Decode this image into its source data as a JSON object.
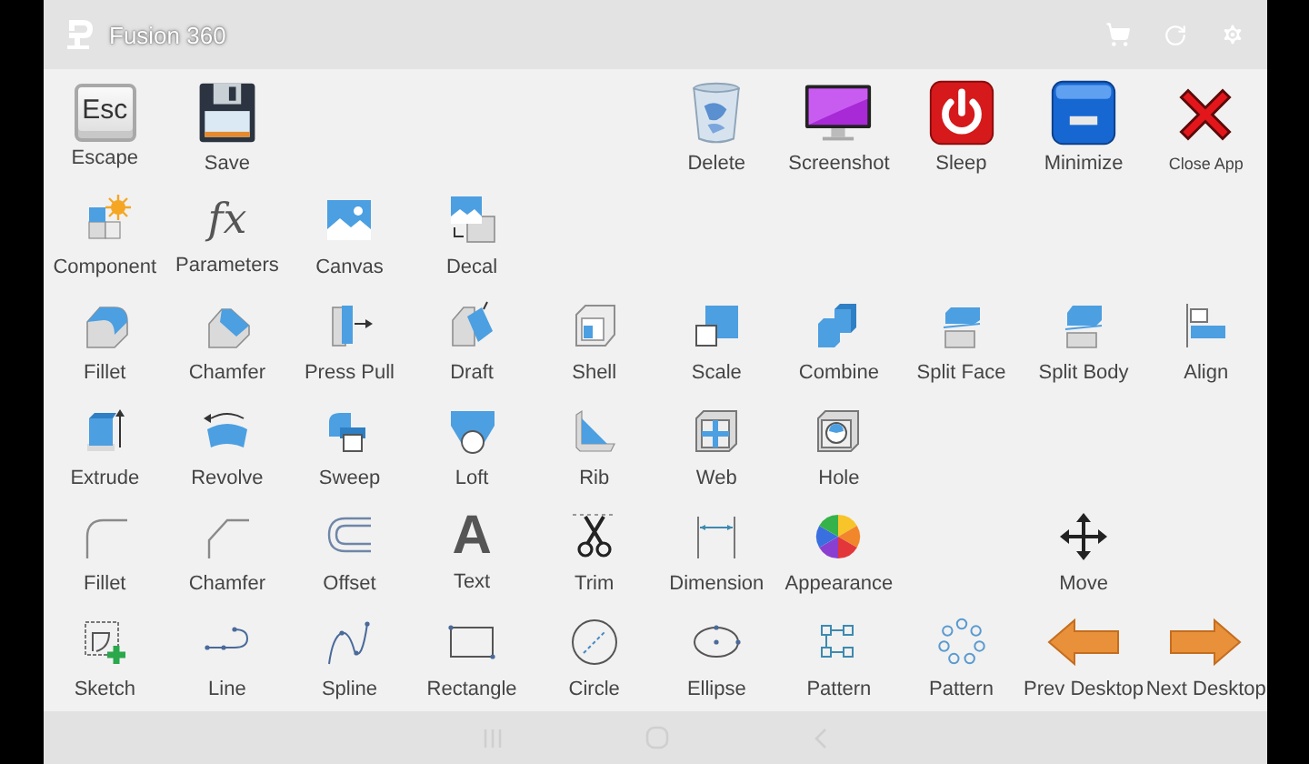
{
  "app": {
    "title": "Fusion 360"
  },
  "rows": [
    [
      {
        "kind": "key",
        "label": "Escape",
        "glyph": "Esc"
      },
      {
        "kind": "tool",
        "label": "Save"
      },
      {
        "kind": "empty"
      },
      {
        "kind": "empty"
      },
      {
        "kind": "empty"
      },
      {
        "kind": "tool",
        "label": "Delete"
      },
      {
        "kind": "tool",
        "label": "Screenshot"
      },
      {
        "kind": "tool",
        "label": "Sleep"
      },
      {
        "kind": "tool",
        "label": "Minimize"
      },
      {
        "kind": "small-tool",
        "label": "Close App"
      }
    ],
    [
      {
        "kind": "tool",
        "label": "Component"
      },
      {
        "kind": "formula",
        "label": "Parameters",
        "glyph": "fx"
      },
      {
        "kind": "tool",
        "label": "Canvas"
      },
      {
        "kind": "tool",
        "label": "Decal"
      },
      {
        "kind": "empty"
      },
      {
        "kind": "empty"
      },
      {
        "kind": "empty"
      },
      {
        "kind": "empty"
      },
      {
        "kind": "empty"
      },
      {
        "kind": "empty"
      }
    ],
    [
      {
        "kind": "tool",
        "label": "Fillet"
      },
      {
        "kind": "tool",
        "label": "Chamfer"
      },
      {
        "kind": "tool",
        "label": "Press Pull"
      },
      {
        "kind": "tool",
        "label": "Draft"
      },
      {
        "kind": "tool",
        "label": "Shell"
      },
      {
        "kind": "tool",
        "label": "Scale"
      },
      {
        "kind": "tool",
        "label": "Combine"
      },
      {
        "kind": "tool",
        "label": "Split Face"
      },
      {
        "kind": "tool",
        "label": "Split Body"
      },
      {
        "kind": "tool",
        "label": "Align"
      }
    ],
    [
      {
        "kind": "tool",
        "label": "Extrude"
      },
      {
        "kind": "tool",
        "label": "Revolve"
      },
      {
        "kind": "tool",
        "label": "Sweep"
      },
      {
        "kind": "tool",
        "label": "Loft"
      },
      {
        "kind": "tool",
        "label": "Rib"
      },
      {
        "kind": "tool",
        "label": "Web"
      },
      {
        "kind": "tool",
        "label": "Hole"
      },
      {
        "kind": "empty"
      },
      {
        "kind": "empty"
      },
      {
        "kind": "empty"
      }
    ],
    [
      {
        "kind": "tool",
        "label": "Fillet"
      },
      {
        "kind": "tool",
        "label": "Chamfer"
      },
      {
        "kind": "tool",
        "label": "Offset"
      },
      {
        "kind": "letter",
        "label": "Text",
        "glyph": "A"
      },
      {
        "kind": "tool",
        "label": "Trim"
      },
      {
        "kind": "tool",
        "label": "Dimension"
      },
      {
        "kind": "tool",
        "label": "Appearance"
      },
      {
        "kind": "empty"
      },
      {
        "kind": "tool",
        "label": "Move"
      },
      {
        "kind": "empty"
      }
    ],
    [
      {
        "kind": "tool",
        "label": "Sketch"
      },
      {
        "kind": "tool",
        "label": "Line"
      },
      {
        "kind": "tool",
        "label": "Spline"
      },
      {
        "kind": "tool",
        "label": "Rectangle"
      },
      {
        "kind": "tool",
        "label": "Circle"
      },
      {
        "kind": "tool",
        "label": "Ellipse"
      },
      {
        "kind": "tool",
        "label": "Pattern"
      },
      {
        "kind": "tool",
        "label": "Pattern"
      },
      {
        "kind": "tool",
        "label": "Prev Desktop"
      },
      {
        "kind": "tool",
        "label": "Next Desktop"
      }
    ]
  ]
}
